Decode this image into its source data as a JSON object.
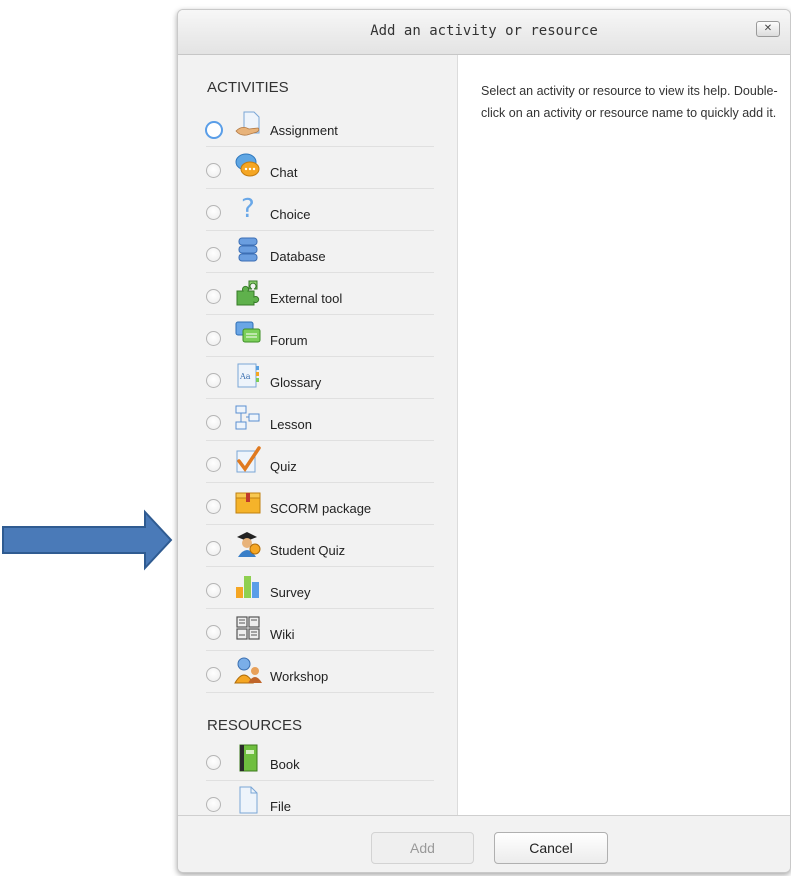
{
  "dialog": {
    "title": "Add an activity or resource",
    "close_label": "✕",
    "help_text": "Select an activity or resource to view its help. Double-click on an activity or resource name to quickly add it.",
    "add_label": "Add",
    "cancel_label": "Cancel"
  },
  "activities_header": "ACTIVITIES",
  "resources_header": "RESOURCES",
  "activities": [
    {
      "label": "Assignment",
      "icon": "assignment-icon"
    },
    {
      "label": "Chat",
      "icon": "chat-icon"
    },
    {
      "label": "Choice",
      "icon": "choice-icon"
    },
    {
      "label": "Database",
      "icon": "database-icon"
    },
    {
      "label": "External tool",
      "icon": "external-tool-icon"
    },
    {
      "label": "Forum",
      "icon": "forum-icon"
    },
    {
      "label": "Glossary",
      "icon": "glossary-icon"
    },
    {
      "label": "Lesson",
      "icon": "lesson-icon"
    },
    {
      "label": "Quiz",
      "icon": "quiz-icon"
    },
    {
      "label": "SCORM package",
      "icon": "scorm-package-icon"
    },
    {
      "label": "Student Quiz",
      "icon": "student-quiz-icon"
    },
    {
      "label": "Survey",
      "icon": "survey-icon"
    },
    {
      "label": "Wiki",
      "icon": "wiki-icon"
    },
    {
      "label": "Workshop",
      "icon": "workshop-icon"
    }
  ],
  "resources": [
    {
      "label": "Book",
      "icon": "book-icon"
    },
    {
      "label": "File",
      "icon": "file-icon"
    }
  ],
  "colors": {
    "arrow_fill": "#4a7ab8",
    "arrow_stroke": "#2f5b91",
    "focus_ring": "#5a9ee8"
  }
}
